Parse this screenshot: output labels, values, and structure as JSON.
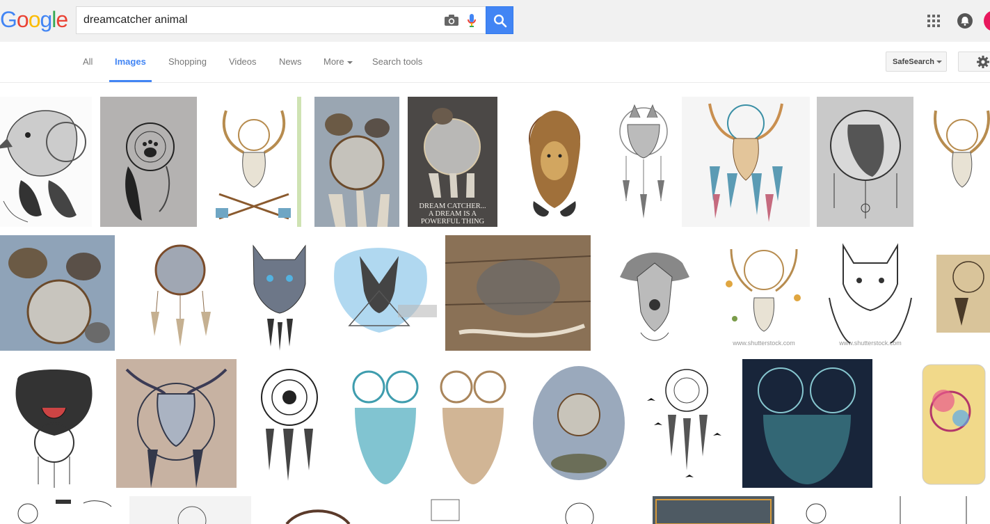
{
  "header": {
    "logo_letters": [
      "G",
      "o",
      "o",
      "g",
      "l",
      "e"
    ],
    "logo_colors": [
      "#4285f4",
      "#ea4335",
      "#fbbc05",
      "#4285f4",
      "#34a853",
      "#ea4335"
    ],
    "search_query": "dreamcatcher animal",
    "icons": [
      "camera-icon",
      "microphone-icon",
      "search-icon",
      "apps-grid-icon",
      "notifications-icon"
    ]
  },
  "tabs": {
    "items": [
      {
        "label": "All"
      },
      {
        "label": "Images"
      },
      {
        "label": "Shopping"
      },
      {
        "label": "Videos"
      },
      {
        "label": "News"
      },
      {
        "label": "More"
      },
      {
        "label": "Search tools"
      }
    ],
    "active": "Images",
    "accent": "#4285f4"
  },
  "tools": {
    "safesearch_label": "SafeSearch",
    "settings_icon": "gear-icon"
  },
  "results": {
    "caption_lines": [
      "DREAM CATCHER...",
      "A DREAM IS A",
      "POWERFUL THING"
    ],
    "watermark_text": "www.shutterstock.com"
  }
}
